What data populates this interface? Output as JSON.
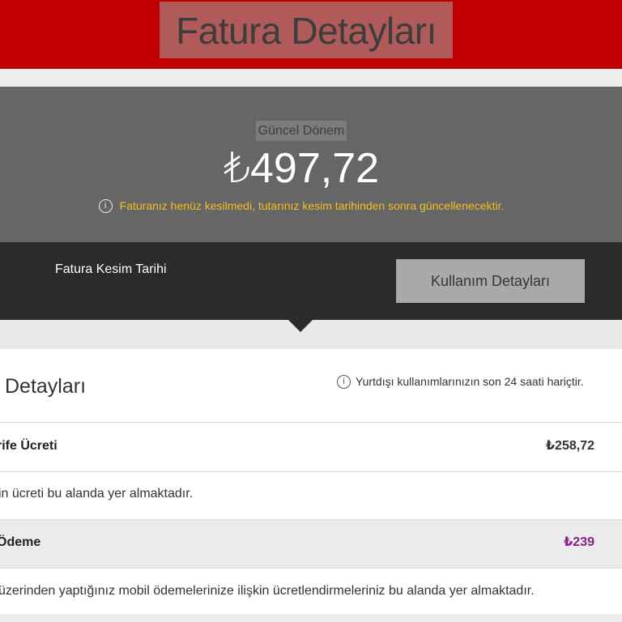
{
  "header": {
    "title": "Fatura Detayları"
  },
  "summary": {
    "period_label": "Güncel Dönem",
    "amount": "₺497,72",
    "info_icon": "info-circle-icon",
    "note": "Faturanız henüz kesilmedi, tutarınız kesim tarihinden sonra güncellenecektir."
  },
  "bar": {
    "cut_date_label": "Fatura Kesim Tarihi",
    "usage_button": "Kullanım Detayları"
  },
  "details": {
    "title": "Detayları",
    "note": "Yurtdışı kullanımlarınızın son 24 saati hariçtir.",
    "rows": [
      {
        "label": "rife Ücreti",
        "value": "₺258,72",
        "desc": "in ücreti bu alanda yer almaktadır."
      },
      {
        "label": "Ödeme",
        "value": "₺239",
        "desc": "üzerinden yaptığınız mobil ödemelerinize ilişkin ücretlendirmeleriniz bu alanda yer almaktadır."
      }
    ]
  },
  "colors": {
    "header": "#c00000",
    "summary": "#666666",
    "dark_bar": "#2b2b2b",
    "note": "#f0c020",
    "purple_value": "#8a1f8a"
  }
}
